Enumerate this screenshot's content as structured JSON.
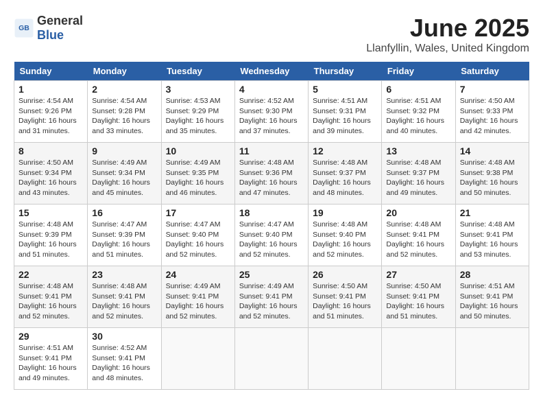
{
  "header": {
    "logo_general": "General",
    "logo_blue": "Blue",
    "title": "June 2025",
    "subtitle": "Llanfyllin, Wales, United Kingdom"
  },
  "calendar": {
    "days_of_week": [
      "Sunday",
      "Monday",
      "Tuesday",
      "Wednesday",
      "Thursday",
      "Friday",
      "Saturday"
    ],
    "weeks": [
      [
        null,
        null,
        null,
        null,
        null,
        null,
        null
      ]
    ],
    "cells": [
      {
        "day": null,
        "content": null
      },
      {
        "day": null,
        "content": null
      },
      {
        "day": null,
        "content": null
      },
      {
        "day": null,
        "content": null
      },
      {
        "day": null,
        "content": null
      },
      {
        "day": null,
        "content": null
      },
      {
        "day": null,
        "content": null
      }
    ]
  },
  "weeks": [
    [
      {
        "day": "1",
        "sunrise": "Sunrise: 4:54 AM",
        "sunset": "Sunset: 9:26 PM",
        "daylight": "Daylight: 16 hours and 31 minutes."
      },
      {
        "day": "2",
        "sunrise": "Sunrise: 4:54 AM",
        "sunset": "Sunset: 9:28 PM",
        "daylight": "Daylight: 16 hours and 33 minutes."
      },
      {
        "day": "3",
        "sunrise": "Sunrise: 4:53 AM",
        "sunset": "Sunset: 9:29 PM",
        "daylight": "Daylight: 16 hours and 35 minutes."
      },
      {
        "day": "4",
        "sunrise": "Sunrise: 4:52 AM",
        "sunset": "Sunset: 9:30 PM",
        "daylight": "Daylight: 16 hours and 37 minutes."
      },
      {
        "day": "5",
        "sunrise": "Sunrise: 4:51 AM",
        "sunset": "Sunset: 9:31 PM",
        "daylight": "Daylight: 16 hours and 39 minutes."
      },
      {
        "day": "6",
        "sunrise": "Sunrise: 4:51 AM",
        "sunset": "Sunset: 9:32 PM",
        "daylight": "Daylight: 16 hours and 40 minutes."
      },
      {
        "day": "7",
        "sunrise": "Sunrise: 4:50 AM",
        "sunset": "Sunset: 9:33 PM",
        "daylight": "Daylight: 16 hours and 42 minutes."
      }
    ],
    [
      {
        "day": "8",
        "sunrise": "Sunrise: 4:50 AM",
        "sunset": "Sunset: 9:34 PM",
        "daylight": "Daylight: 16 hours and 43 minutes."
      },
      {
        "day": "9",
        "sunrise": "Sunrise: 4:49 AM",
        "sunset": "Sunset: 9:34 PM",
        "daylight": "Daylight: 16 hours and 45 minutes."
      },
      {
        "day": "10",
        "sunrise": "Sunrise: 4:49 AM",
        "sunset": "Sunset: 9:35 PM",
        "daylight": "Daylight: 16 hours and 46 minutes."
      },
      {
        "day": "11",
        "sunrise": "Sunrise: 4:48 AM",
        "sunset": "Sunset: 9:36 PM",
        "daylight": "Daylight: 16 hours and 47 minutes."
      },
      {
        "day": "12",
        "sunrise": "Sunrise: 4:48 AM",
        "sunset": "Sunset: 9:37 PM",
        "daylight": "Daylight: 16 hours and 48 minutes."
      },
      {
        "day": "13",
        "sunrise": "Sunrise: 4:48 AM",
        "sunset": "Sunset: 9:37 PM",
        "daylight": "Daylight: 16 hours and 49 minutes."
      },
      {
        "day": "14",
        "sunrise": "Sunrise: 4:48 AM",
        "sunset": "Sunset: 9:38 PM",
        "daylight": "Daylight: 16 hours and 50 minutes."
      }
    ],
    [
      {
        "day": "15",
        "sunrise": "Sunrise: 4:48 AM",
        "sunset": "Sunset: 9:39 PM",
        "daylight": "Daylight: 16 hours and 51 minutes."
      },
      {
        "day": "16",
        "sunrise": "Sunrise: 4:47 AM",
        "sunset": "Sunset: 9:39 PM",
        "daylight": "Daylight: 16 hours and 51 minutes."
      },
      {
        "day": "17",
        "sunrise": "Sunrise: 4:47 AM",
        "sunset": "Sunset: 9:40 PM",
        "daylight": "Daylight: 16 hours and 52 minutes."
      },
      {
        "day": "18",
        "sunrise": "Sunrise: 4:47 AM",
        "sunset": "Sunset: 9:40 PM",
        "daylight": "Daylight: 16 hours and 52 minutes."
      },
      {
        "day": "19",
        "sunrise": "Sunrise: 4:48 AM",
        "sunset": "Sunset: 9:40 PM",
        "daylight": "Daylight: 16 hours and 52 minutes."
      },
      {
        "day": "20",
        "sunrise": "Sunrise: 4:48 AM",
        "sunset": "Sunset: 9:41 PM",
        "daylight": "Daylight: 16 hours and 52 minutes."
      },
      {
        "day": "21",
        "sunrise": "Sunrise: 4:48 AM",
        "sunset": "Sunset: 9:41 PM",
        "daylight": "Daylight: 16 hours and 53 minutes."
      }
    ],
    [
      {
        "day": "22",
        "sunrise": "Sunrise: 4:48 AM",
        "sunset": "Sunset: 9:41 PM",
        "daylight": "Daylight: 16 hours and 52 minutes."
      },
      {
        "day": "23",
        "sunrise": "Sunrise: 4:48 AM",
        "sunset": "Sunset: 9:41 PM",
        "daylight": "Daylight: 16 hours and 52 minutes."
      },
      {
        "day": "24",
        "sunrise": "Sunrise: 4:49 AM",
        "sunset": "Sunset: 9:41 PM",
        "daylight": "Daylight: 16 hours and 52 minutes."
      },
      {
        "day": "25",
        "sunrise": "Sunrise: 4:49 AM",
        "sunset": "Sunset: 9:41 PM",
        "daylight": "Daylight: 16 hours and 52 minutes."
      },
      {
        "day": "26",
        "sunrise": "Sunrise: 4:50 AM",
        "sunset": "Sunset: 9:41 PM",
        "daylight": "Daylight: 16 hours and 51 minutes."
      },
      {
        "day": "27",
        "sunrise": "Sunrise: 4:50 AM",
        "sunset": "Sunset: 9:41 PM",
        "daylight": "Daylight: 16 hours and 51 minutes."
      },
      {
        "day": "28",
        "sunrise": "Sunrise: 4:51 AM",
        "sunset": "Sunset: 9:41 PM",
        "daylight": "Daylight: 16 hours and 50 minutes."
      }
    ],
    [
      {
        "day": "29",
        "sunrise": "Sunrise: 4:51 AM",
        "sunset": "Sunset: 9:41 PM",
        "daylight": "Daylight: 16 hours and 49 minutes."
      },
      {
        "day": "30",
        "sunrise": "Sunrise: 4:52 AM",
        "sunset": "Sunset: 9:41 PM",
        "daylight": "Daylight: 16 hours and 48 minutes."
      },
      null,
      null,
      null,
      null,
      null
    ]
  ]
}
